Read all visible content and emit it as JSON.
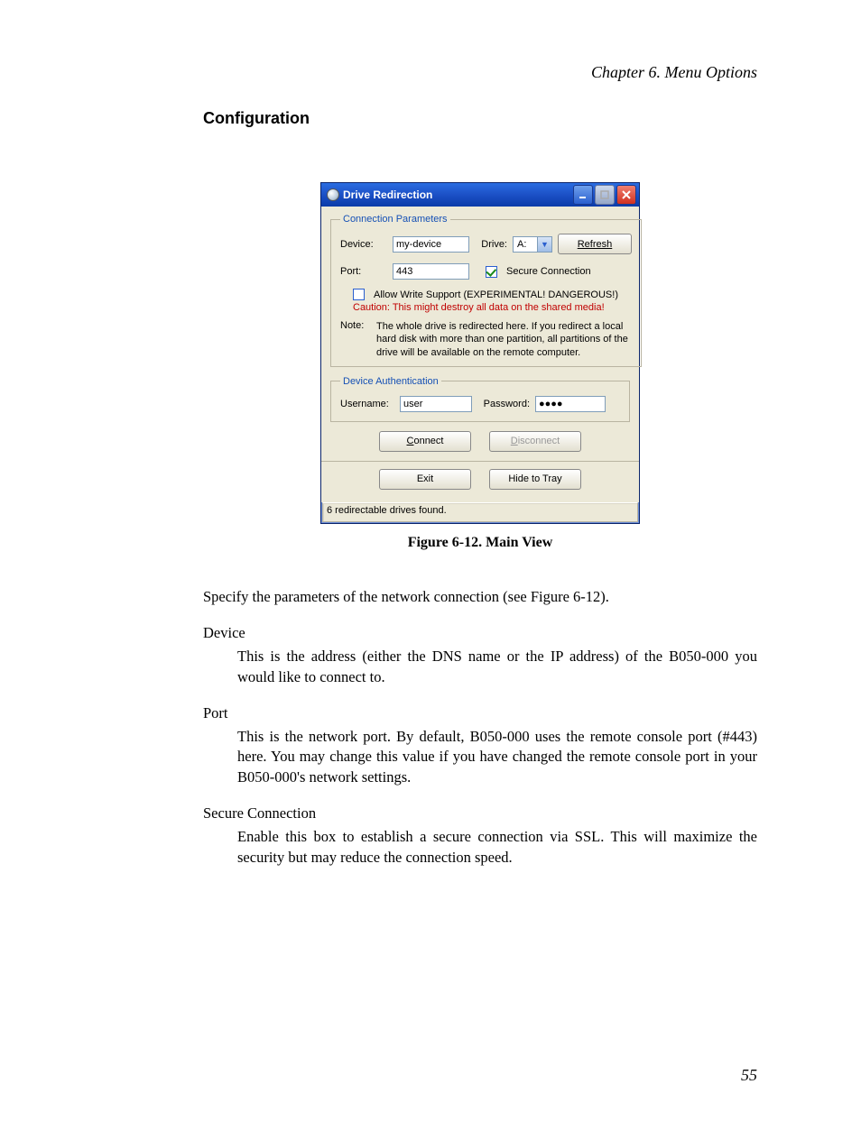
{
  "header": {
    "chapter": "Chapter 6. Menu Options",
    "section_title": "Configuration"
  },
  "window": {
    "title": "Drive Redirection",
    "connection_legend": "Connection Parameters",
    "device_label": "Device:",
    "device_value": "my-device",
    "drive_label": "Drive:",
    "drive_value": "A:",
    "refresh": "Refresh",
    "port_label": "Port:",
    "port_value": "443",
    "secure_label": "Secure Connection",
    "allow_write_label": "Allow Write Support (EXPERIMENTAL! DANGEROUS!)",
    "caution": "Caution: This might destroy all data on the shared media!",
    "note_label": "Note:",
    "note_text": "The whole drive is redirected here. If you redirect a local hard disk with more than one partition, all partitions of the drive will be available on the remote computer.",
    "auth_legend": "Device Authentication",
    "username_label": "Username:",
    "username_value": "user",
    "password_label": "Password:",
    "password_value": "●●●●",
    "connect": "onnect",
    "connect_prefix": "C",
    "disconnect": "isconnect",
    "disconnect_prefix": "D",
    "exit": "Exit",
    "hide": "Hide to Tray",
    "status": "6 redirectable drives found."
  },
  "figure": {
    "caption": "Figure 6-12. Main View"
  },
  "prose": {
    "intro": "Specify the parameters of the network connection (see Figure 6-12).",
    "device_term": "Device",
    "device_def": "This is the address (either the DNS name or the IP address) of the B050-000 you would like to connect to.",
    "port_term": "Port",
    "port_def": "This is the network port. By default, B050-000 uses the remote console port (#443) here. You may change this value if you have changed the remote console port in your B050-000's network settings.",
    "secure_term": "Secure Connection",
    "secure_def": "Enable this box to establish a secure connection via SSL. This will maximize the security but may reduce the connection speed."
  },
  "pagenum": "55"
}
